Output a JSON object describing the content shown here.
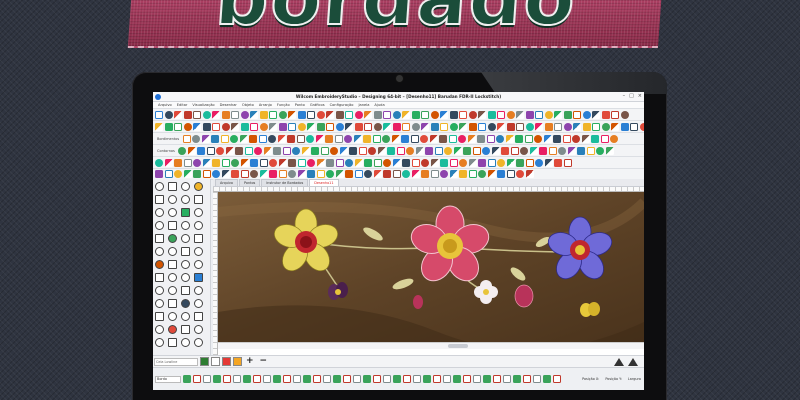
{
  "banner": {
    "title": "bordado"
  },
  "app": {
    "window_title": "Wilcom EmbroideryStudio – Designing 64-bit – [Desenho11]      Barudan FDR-II Lockstitch)",
    "menu": [
      "Arquivo",
      "Editar",
      "Visualização",
      "Desenhar",
      "Objeto",
      "Arranjo",
      "Função",
      "Ponto",
      "Gráficos",
      "Configuração",
      "Janela",
      "Ajuda"
    ],
    "toolbar_labels": {
      "row3": "Bordimentos",
      "row4": "Contornos"
    },
    "tabs": [
      "Arquivo",
      "Pontos",
      "Instrutor de Bordados",
      "Desenho11"
    ],
    "active_tab_index": 3,
    "color_field_text": "Cela Lowline",
    "stitch_field_text": "Bordo",
    "status": {
      "pos1": "Posição X:",
      "pos2": "Posição Y:",
      "width": "Largura"
    }
  },
  "colors": {
    "toolbar_palette": [
      "#e04a3a",
      "#2a7fd4",
      "#3aa35a",
      "#f0b429",
      "#8e44ad",
      "#e67e22",
      "#1abc9c",
      "#c0392b",
      "#34495e",
      "#d35400",
      "#27ae60",
      "#2980b9",
      "#7f8c8d",
      "#e91e63",
      "#795548"
    ],
    "swatches": [
      "#2e7d32",
      "#ffffff",
      "#e53935",
      "#f5a623"
    ]
  }
}
